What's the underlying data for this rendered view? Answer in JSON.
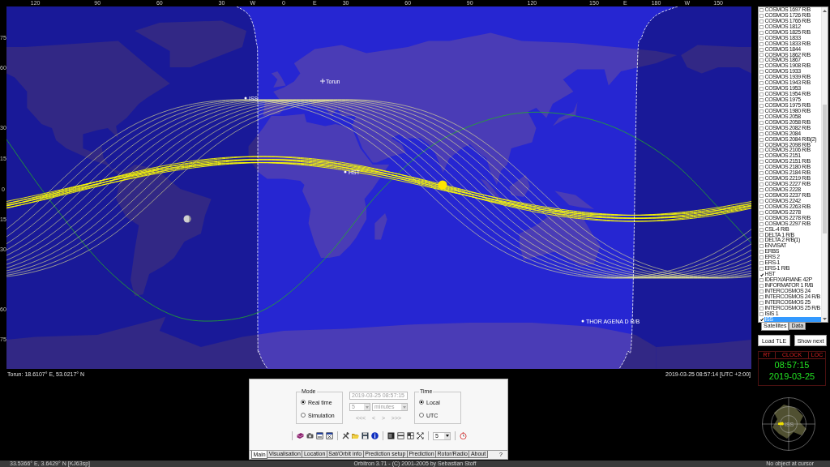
{
  "map": {
    "longitude_labels": [
      "120",
      "90",
      "60",
      "30",
      "W",
      "0",
      "E",
      "30",
      "60",
      "90",
      "120",
      "150",
      "E",
      "180",
      "W",
      "150"
    ],
    "latitude_labels": [
      "75",
      "60",
      "30",
      "15",
      "0",
      "15",
      "30",
      "60",
      "75"
    ],
    "markers": [
      {
        "label": "Torun",
        "kind": "location"
      },
      {
        "label": "ISS",
        "kind": "satellite"
      },
      {
        "label": "HST",
        "kind": "satellite"
      },
      {
        "label": "THOR AGENA D R/B",
        "kind": "satellite"
      }
    ],
    "location_readout": "Torun: 18.6107° E, 53.0217° N",
    "time_readout": "2019-03-25 08:57:14 [UTC +2:00]"
  },
  "satellite_list": {
    "items": [
      {
        "name": "COSMOS 1697 R/B",
        "checked": false,
        "selected": false
      },
      {
        "name": "COSMOS 1726 R/B",
        "checked": false,
        "selected": false
      },
      {
        "name": "COSMOS 1766 R/B",
        "checked": false,
        "selected": false
      },
      {
        "name": "COSMOS 1812",
        "checked": false,
        "selected": false
      },
      {
        "name": "COSMOS 1825 R/B",
        "checked": false,
        "selected": false
      },
      {
        "name": "COSMOS 1833",
        "checked": false,
        "selected": false
      },
      {
        "name": "COSMOS 1833 R/B",
        "checked": false,
        "selected": false
      },
      {
        "name": "COSMOS 1844",
        "checked": false,
        "selected": false
      },
      {
        "name": "COSMOS 1862 R/B",
        "checked": false,
        "selected": false
      },
      {
        "name": "COSMOS 1867",
        "checked": false,
        "selected": false
      },
      {
        "name": "COSMOS 1908 R/B",
        "checked": false,
        "selected": false
      },
      {
        "name": "COSMOS 1933",
        "checked": false,
        "selected": false
      },
      {
        "name": "COSMOS 1939 R/B",
        "checked": false,
        "selected": false
      },
      {
        "name": "COSMOS 1943 R/B",
        "checked": false,
        "selected": false
      },
      {
        "name": "COSMOS 1953",
        "checked": false,
        "selected": false
      },
      {
        "name": "COSMOS 1954 R/B",
        "checked": false,
        "selected": false
      },
      {
        "name": "COSMOS 1975",
        "checked": false,
        "selected": false
      },
      {
        "name": "COSMOS 1975 R/B",
        "checked": false,
        "selected": false
      },
      {
        "name": "COSMOS 1980 R/B",
        "checked": false,
        "selected": false
      },
      {
        "name": "COSMOS 2058",
        "checked": false,
        "selected": false
      },
      {
        "name": "COSMOS 2058 R/B",
        "checked": false,
        "selected": false
      },
      {
        "name": "COSMOS 2082 R/B",
        "checked": false,
        "selected": false
      },
      {
        "name": "COSMOS 2084",
        "checked": false,
        "selected": false
      },
      {
        "name": "COSMOS 2084 R/B(2)",
        "checked": false,
        "selected": false
      },
      {
        "name": "COSMOS 2098 R/B",
        "checked": false,
        "selected": false
      },
      {
        "name": "COSMOS 2106 R/B",
        "checked": false,
        "selected": false
      },
      {
        "name": "COSMOS 2151",
        "checked": false,
        "selected": false
      },
      {
        "name": "COSMOS 2151 R/B",
        "checked": false,
        "selected": false
      },
      {
        "name": "COSMOS 2180 R/B",
        "checked": false,
        "selected": false
      },
      {
        "name": "COSMOS 2184 R/B",
        "checked": false,
        "selected": false
      },
      {
        "name": "COSMOS 2219 R/B",
        "checked": false,
        "selected": false
      },
      {
        "name": "COSMOS 2227 R/B",
        "checked": false,
        "selected": false
      },
      {
        "name": "COSMOS 2228",
        "checked": false,
        "selected": false
      },
      {
        "name": "COSMOS 2237 R/B",
        "checked": false,
        "selected": false
      },
      {
        "name": "COSMOS 2242",
        "checked": false,
        "selected": false
      },
      {
        "name": "COSMOS 2263 R/B",
        "checked": false,
        "selected": false
      },
      {
        "name": "COSMOS 2278",
        "checked": false,
        "selected": false
      },
      {
        "name": "COSMOS 2278 R/B",
        "checked": false,
        "selected": false
      },
      {
        "name": "COSMOS 2297 R/B",
        "checked": false,
        "selected": false
      },
      {
        "name": "CSL-4 R/B",
        "checked": false,
        "selected": false
      },
      {
        "name": "DELTA 1 R/B",
        "checked": false,
        "selected": false
      },
      {
        "name": "DELTA 2 R/B(1)",
        "checked": false,
        "selected": false
      },
      {
        "name": "ENVISAT",
        "checked": false,
        "selected": false
      },
      {
        "name": "ERBS",
        "checked": false,
        "selected": false
      },
      {
        "name": "ERS 2",
        "checked": false,
        "selected": false
      },
      {
        "name": "ERS-1",
        "checked": false,
        "selected": false
      },
      {
        "name": "ERS-1 R/B",
        "checked": false,
        "selected": false
      },
      {
        "name": "HST",
        "checked": true,
        "selected": false
      },
      {
        "name": "IDEFIX/ARIANE 42P",
        "checked": false,
        "selected": false
      },
      {
        "name": "INFORMATOR 1 R/B",
        "checked": false,
        "selected": false
      },
      {
        "name": "INTERCOSMOS 24",
        "checked": false,
        "selected": false
      },
      {
        "name": "INTERCOSMOS 24 R/B",
        "checked": false,
        "selected": false
      },
      {
        "name": "INTERCOSMOS 25",
        "checked": false,
        "selected": false
      },
      {
        "name": "INTERCOSMOS 25 R/B",
        "checked": false,
        "selected": false
      },
      {
        "name": "ISIS 1",
        "checked": false,
        "selected": false
      },
      {
        "name": "ISS",
        "checked": true,
        "selected": true
      }
    ],
    "tabs": [
      {
        "label": "Satellites",
        "selected": true
      },
      {
        "label": "Data",
        "selected": false
      }
    ]
  },
  "buttons": [
    "Load TLE",
    "Show next"
  ],
  "clock": {
    "headers": [
      "RT",
      "CLOCK",
      "LOC"
    ],
    "time": "08:57:15",
    "date": "2019-03-25"
  },
  "radar": {
    "satellite_label": "ISS"
  },
  "control_panel": {
    "mode": {
      "title": "Mode",
      "options": [
        {
          "label": "Real time",
          "selected": true
        },
        {
          "label": "Simulation",
          "selected": false
        }
      ]
    },
    "simulation": {
      "disabled": true,
      "datetime": "2019-03-25 08:57:15",
      "step": "5",
      "unit": "minutes",
      "buttons": [
        "<<<",
        "<",
        ">",
        ">>>"
      ]
    },
    "time": {
      "title": "Time",
      "options": [
        {
          "label": "Local",
          "selected": true
        },
        {
          "label": "UTC",
          "selected": false
        }
      ]
    },
    "toolbar": {
      "interval": "5"
    },
    "tabs": [
      {
        "label": "Main",
        "selected": true
      },
      {
        "label": "Visualisation",
        "selected": false
      },
      {
        "label": "Location",
        "selected": false
      },
      {
        "label": "Sat/Orbit info",
        "selected": false
      },
      {
        "label": "Prediction setup",
        "selected": false
      },
      {
        "label": "Prediction",
        "selected": false
      },
      {
        "label": "Rotor/Radio",
        "selected": false
      },
      {
        "label": "About",
        "selected": false
      }
    ],
    "help": "?"
  },
  "status_bar": {
    "cursor": "33.5366° E, 3.6429° N [KJ63sp]",
    "copyright": "Orbitron 3.71 - (C) 2001-2005 by Sebastian Stoff",
    "object": "No object at cursor"
  }
}
